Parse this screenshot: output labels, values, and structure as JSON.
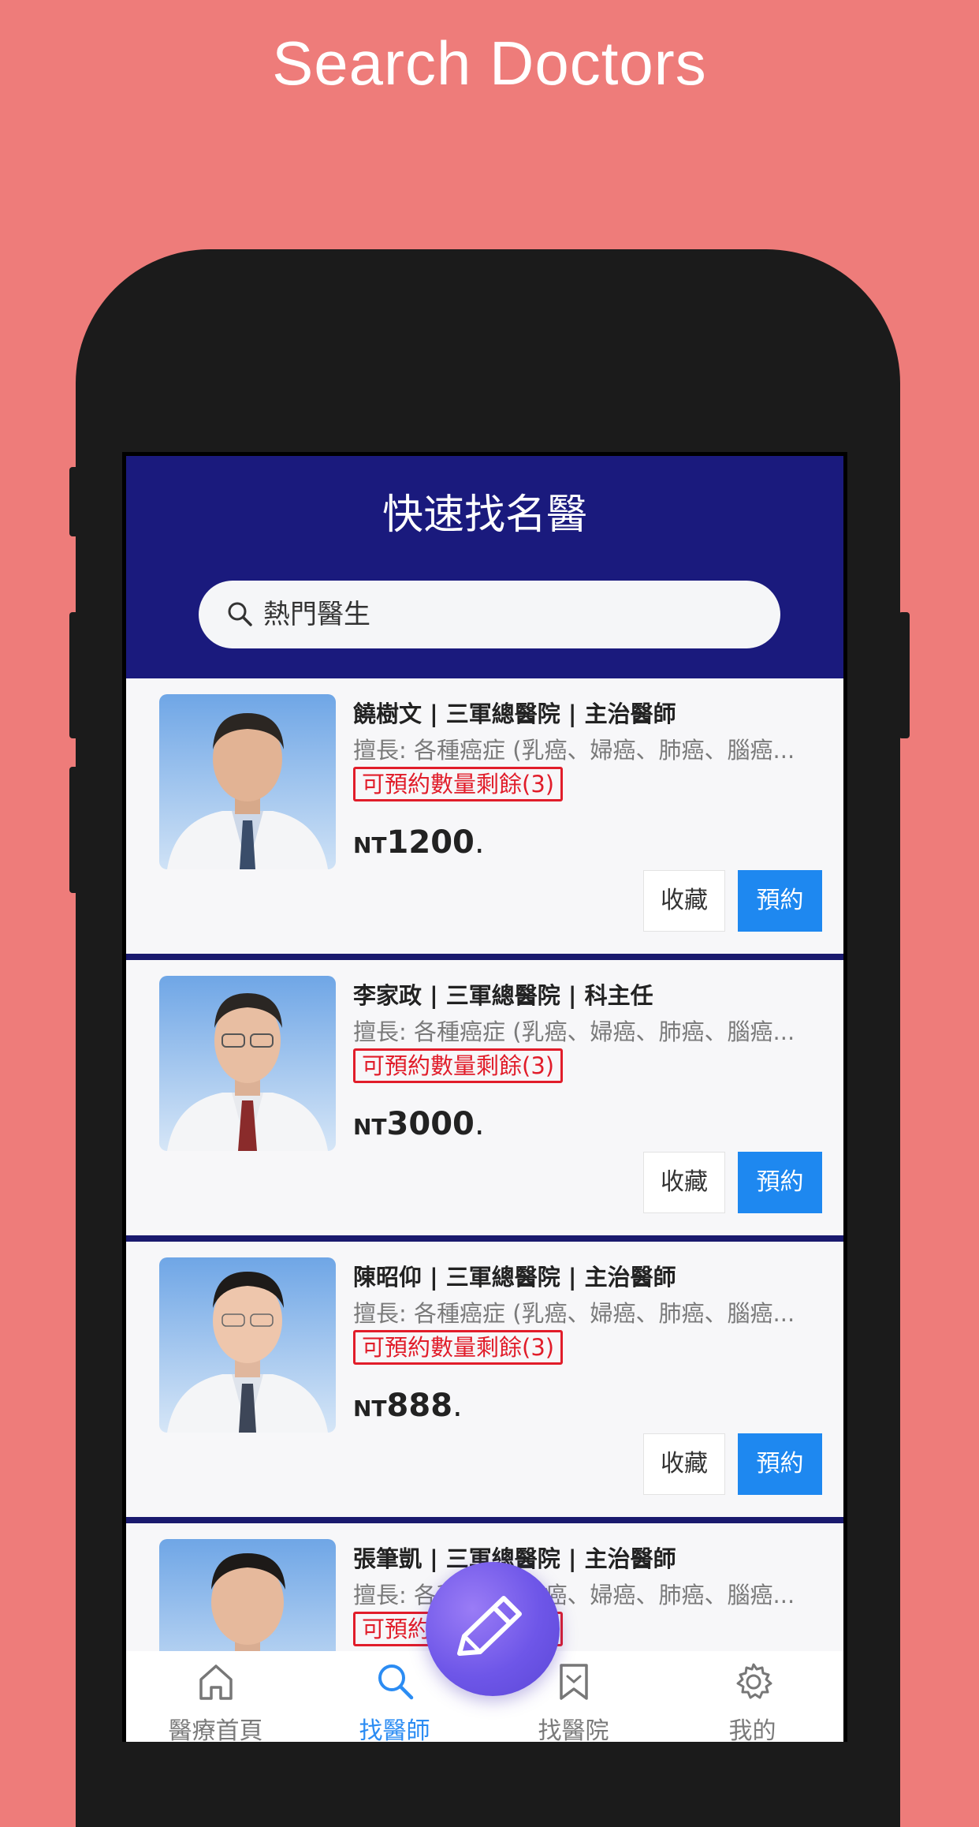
{
  "promo_title": "Search Doctors",
  "header": {
    "title": "快速找名醫",
    "search_placeholder": "熱門醫生"
  },
  "doctors": [
    {
      "title": "饒樹文 | 三軍總醫院 | 主治醫師",
      "specialty": "擅長: 各種癌症 (乳癌、婦癌、肺癌、腦癌...",
      "quota": "可預約數量剩餘(3)",
      "currency": "NT",
      "price": "1200",
      "price_suffix": ".",
      "fav_label": "收藏",
      "book_label": "預約"
    },
    {
      "title": "李家政 | 三軍總醫院 | 科主任",
      "specialty": "擅長: 各種癌症 (乳癌、婦癌、肺癌、腦癌...",
      "quota": "可預約數量剩餘(3)",
      "currency": "NT",
      "price": "3000",
      "price_suffix": ".",
      "fav_label": "收藏",
      "book_label": "預約"
    },
    {
      "title": "陳昭仰 | 三軍總醫院 | 主治醫師",
      "specialty": "擅長: 各種癌症 (乳癌、婦癌、肺癌、腦癌...",
      "quota": "可預約數量剩餘(3)",
      "currency": "NT",
      "price": "888",
      "price_suffix": ".",
      "fav_label": "收藏",
      "book_label": "預約"
    },
    {
      "title": "張筆凱 | 三軍總醫院 | 主治醫師",
      "specialty": "擅長: 各種癌症 (乳癌、婦癌、肺癌、腦癌...",
      "quota": "可預約數量剩餘(3)"
    }
  ],
  "tabbar": {
    "items": [
      {
        "label": "醫療首頁",
        "icon": "home-icon",
        "active": false
      },
      {
        "label": "找醫師",
        "icon": "search-icon",
        "active": true
      },
      {
        "label": "找醫院",
        "icon": "bookmark-icon",
        "active": false
      },
      {
        "label": "我的",
        "icon": "gear-icon",
        "active": false
      }
    ]
  },
  "fab": {
    "icon": "pencil-icon"
  },
  "colors": {
    "background": "#ee7c7a",
    "header": "#1a1a7d",
    "accent": "#1e88f0",
    "quota": "#e11d2a",
    "fab": "#6e56e8"
  }
}
